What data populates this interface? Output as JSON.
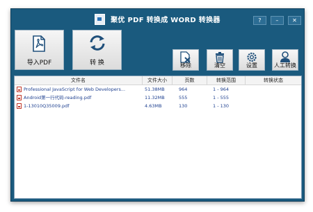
{
  "app": {
    "title": "聚优 PDF 转换成 WORD 转换器"
  },
  "window_buttons": {
    "help": "?",
    "minimize": "–",
    "close": "✕"
  },
  "toolbar": {
    "import_label": "导入PDF",
    "convert_label": "转 换",
    "remove_label": "移除",
    "clear_label": "清空",
    "settings_label": "设置",
    "manual_label": "人工转换"
  },
  "table": {
    "headers": [
      "文件名",
      "文件大小",
      "页数",
      "转换范围",
      "转换状态"
    ],
    "rows": [
      {
        "name": "Professional JavaScript for Web Developers...",
        "size": "51.38MB",
        "pages": "964",
        "range": "1 - 964",
        "status": ""
      },
      {
        "name": "Android第一行代码-reading.pdf",
        "size": "11.32MB",
        "pages": "555",
        "range": "1 - 555",
        "status": ""
      },
      {
        "name": "1-13010Q35009.pdf",
        "size": "4.63MB",
        "pages": "130",
        "range": "1 - 130",
        "status": ""
      }
    ]
  },
  "colors": {
    "window_bg": "#1a5a7e",
    "accent_icon": "#2a73b8",
    "pdf_red": "#c0392b",
    "link_text": "#1d3f8f"
  },
  "icons": [
    "pdf-file-icon",
    "refresh-icon",
    "remove-file-icon",
    "trash-icon",
    "gear-icon",
    "person-icon"
  ]
}
